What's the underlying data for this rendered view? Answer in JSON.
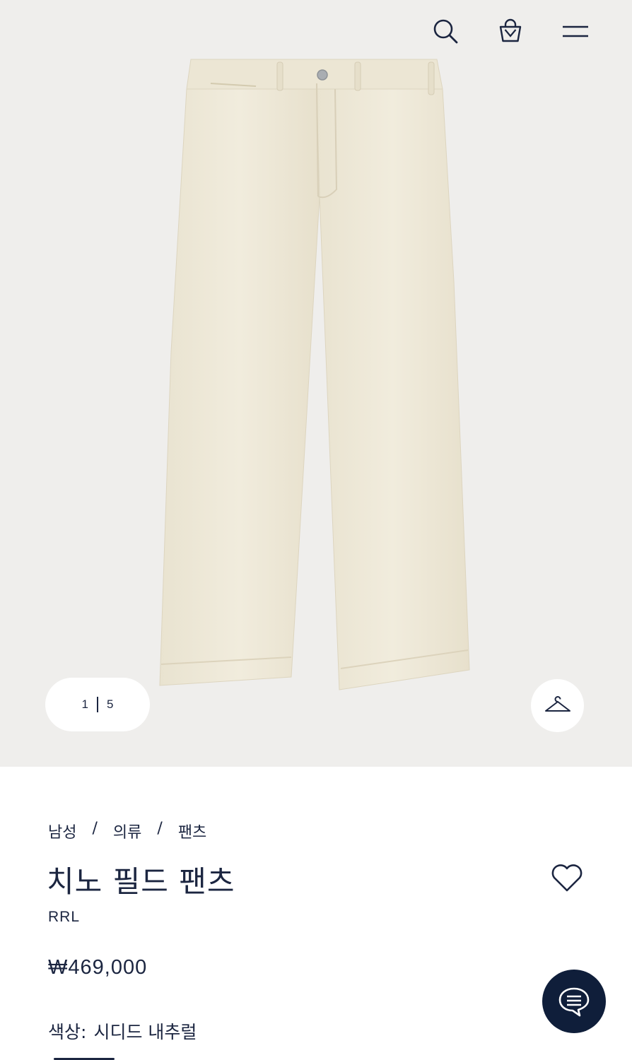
{
  "gallery": {
    "current_page": "1",
    "total_pages": "5"
  },
  "breadcrumb": {
    "items": [
      "남성",
      "의류",
      "팬츠"
    ],
    "separator": "/"
  },
  "product": {
    "title": "치노 필드 팬츠",
    "brand": "RRL",
    "price": "₩469,000",
    "color_label": "색상:",
    "color_value": "시디드 내추럴"
  },
  "icons": {
    "search": "search-icon",
    "bag": "shopping-bag-icon",
    "menu": "hamburger-menu-icon",
    "hanger": "hanger-icon",
    "heart": "heart-icon",
    "chat": "chat-icon"
  },
  "colors": {
    "text": "#1b2540",
    "hero_background": "#efeeec",
    "chat_button": "#0f1e3a",
    "product_fabric": "#efe9d8"
  }
}
